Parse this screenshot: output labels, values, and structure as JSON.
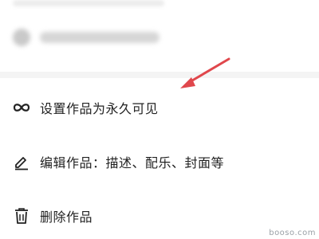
{
  "menu": {
    "items": [
      {
        "label": "设置作品为永久可见",
        "icon": "infinity-icon"
      },
      {
        "label": "编辑作品：描述、配乐、封面等",
        "icon": "edit-pen-icon"
      },
      {
        "label": "删除作品",
        "icon": "trash-icon"
      }
    ]
  },
  "annotation": {
    "arrow_color": "#e0474c"
  },
  "watermark": {
    "text": "booso.com"
  },
  "colors": {
    "text": "#222222",
    "divider": "#f4f4f4"
  }
}
